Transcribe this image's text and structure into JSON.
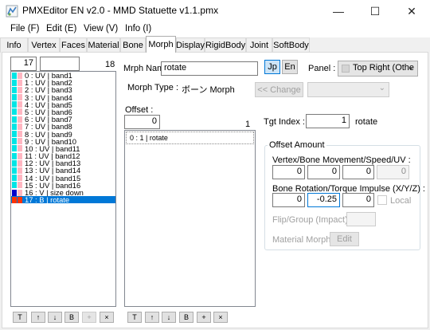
{
  "window": {
    "title": "PMXEditor EN v2.0 - MMD Statuette v1.1.pmx",
    "minimize": "—",
    "maximize": "☐",
    "close": "✕"
  },
  "menu": [
    {
      "label": "File (F)"
    },
    {
      "label": "Edit (E)"
    },
    {
      "label": "View (V)"
    },
    {
      "label": "Info (I)"
    }
  ],
  "tabs": [
    {
      "label": "Info"
    },
    {
      "label": "Vertex"
    },
    {
      "label": "Faces"
    },
    {
      "label": "Material"
    },
    {
      "label": "Bone"
    },
    {
      "label": "Morph"
    },
    {
      "label": "Display"
    },
    {
      "label": "RigidBody"
    },
    {
      "label": "Joint"
    },
    {
      "label": "SoftBody"
    }
  ],
  "active_tab": "Morph",
  "morph_list": {
    "index_value": "17",
    "search_value": "",
    "count": "18",
    "items": [
      {
        "text": "0 : UV | band1",
        "c1": "#00e5e5",
        "c2": "#ffb6c1"
      },
      {
        "text": "1 : UV | band2",
        "c1": "#00e5e5",
        "c2": "#ffb6c1"
      },
      {
        "text": "2 : UV | band3",
        "c1": "#00e5e5",
        "c2": "#ffb6c1"
      },
      {
        "text": "3 : UV | band4",
        "c1": "#00e5e5",
        "c2": "#ffb6c1"
      },
      {
        "text": "4 : UV | band5",
        "c1": "#00e5e5",
        "c2": "#ffb6c1"
      },
      {
        "text": "5 : UV | band6",
        "c1": "#00e5e5",
        "c2": "#ffb6c1"
      },
      {
        "text": "6 : UV | band7",
        "c1": "#00e5e5",
        "c2": "#ffb6c1"
      },
      {
        "text": "7 : UV | band8",
        "c1": "#00e5e5",
        "c2": "#ffb6c1"
      },
      {
        "text": "8 : UV | band9",
        "c1": "#00e5e5",
        "c2": "#ffb6c1"
      },
      {
        "text": "9 : UV | band10",
        "c1": "#00e5e5",
        "c2": "#ffb6c1"
      },
      {
        "text": "10 : UV | band11",
        "c1": "#00e5e5",
        "c2": "#ffb6c1"
      },
      {
        "text": "11 : UV | band12",
        "c1": "#00e5e5",
        "c2": "#ffb6c1"
      },
      {
        "text": "12 : UV | band13",
        "c1": "#00e5e5",
        "c2": "#ffb6c1"
      },
      {
        "text": "13 : UV | band14",
        "c1": "#00e5e5",
        "c2": "#ffb6c1"
      },
      {
        "text": "14 : UV | band15",
        "c1": "#00e5e5",
        "c2": "#ffb6c1"
      },
      {
        "text": "15 : UV | band16",
        "c1": "#00e5e5",
        "c2": "#ffb6c1"
      },
      {
        "text": "16 : V | size down",
        "c1": "#0000cc",
        "c2": "#ffb6c1"
      },
      {
        "text": "17 : B | rotate",
        "c1": "#ff3300",
        "c2": "#ff3300",
        "selected": true
      }
    ],
    "buttons": [
      "T",
      "↑",
      "↓",
      "B",
      "+",
      "×"
    ]
  },
  "morph": {
    "name_label": "Mrph Name:",
    "name_value": "rotate",
    "jp_label": "Jp",
    "en_label": "En",
    "panel_label": "Panel :",
    "panel_value": "Top Right (Othe",
    "type_label": "Morph Type :",
    "type_value": "ボーン Morph",
    "change_label": "<< Change",
    "offset_label": "Offset :",
    "offset_value": "0",
    "offset_count": "1",
    "offset_items": [
      "0 : 1 | rotate"
    ],
    "offset_buttons": [
      "T",
      "↑",
      "↓",
      "B",
      "+",
      "×"
    ]
  },
  "tgt": {
    "label": "Tgt Index :",
    "value": "1",
    "name": "rotate"
  },
  "offset_amount": {
    "group_label": "Offset Amount",
    "vertex_label": "Vertex/Bone Movement/Speed/UV :",
    "vertex_values": [
      "0",
      "0",
      "0",
      "0"
    ],
    "rotation_label": "Bone Rotation/Torque Impulse (X/Y/Z) :",
    "rotation_values": [
      "0",
      "-0.25",
      "0"
    ],
    "local_label": "Local",
    "flip_label": "Flip/Group (Impact) :",
    "flip_value": "",
    "material_label": "Material Morph :",
    "edit_label": "Edit"
  }
}
